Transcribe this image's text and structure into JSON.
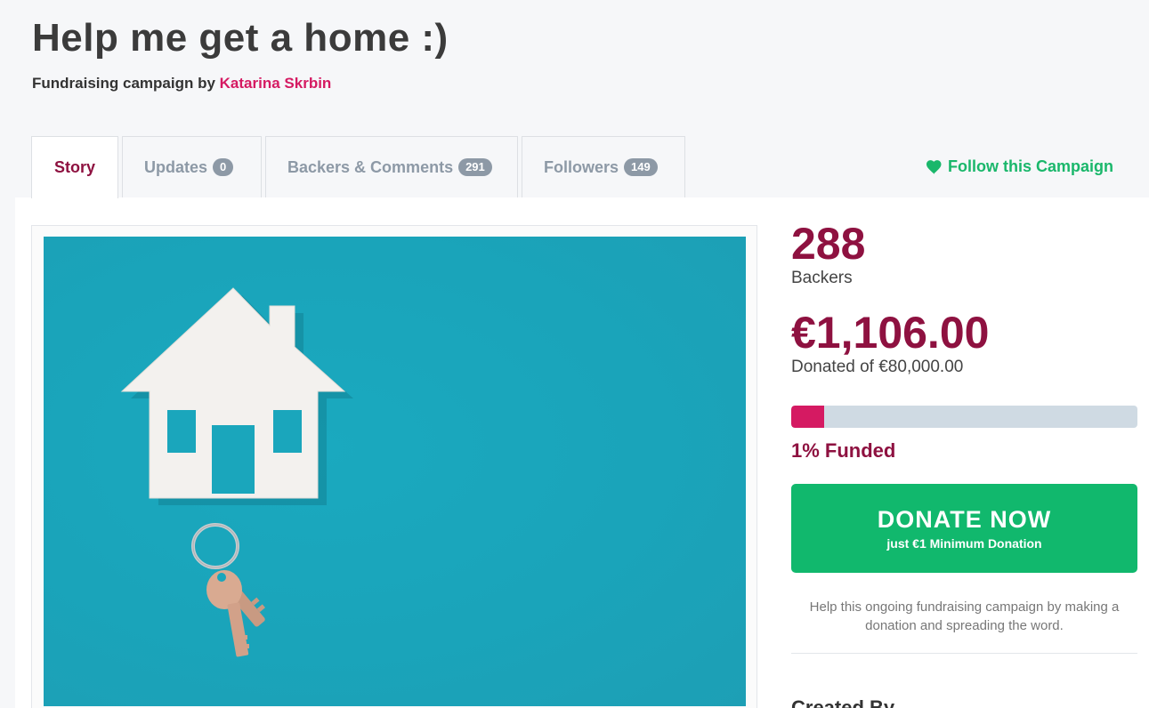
{
  "campaign": {
    "title": "Help me get a home :)",
    "subtitle_prefix": "Fundraising campaign by",
    "author": "Katarina Skrbin"
  },
  "tabs": [
    {
      "label": "Story",
      "count": null
    },
    {
      "label": "Updates",
      "count": "0"
    },
    {
      "label": "Backers & Comments",
      "count": "291"
    },
    {
      "label": "Followers",
      "count": "149"
    }
  ],
  "follow": {
    "label": "Follow this Campaign",
    "icon": "heart-icon"
  },
  "stats": {
    "backers_count": "288",
    "backers_label": "Backers",
    "raised": "€1,106.00",
    "raised_sub": "Donated of €80,000.00",
    "funded_percent": 1,
    "funded_label": "1% Funded"
  },
  "donate": {
    "label": "DONATE NOW",
    "sublabel": "just €1 Minimum Donation"
  },
  "help_text": "Help this ongoing fundraising campaign by making a donation and spreading the word.",
  "created_by_label": "Created By",
  "colors": {
    "brand": "#8e1140",
    "accent": "#d51a62",
    "success": "#11b86d",
    "image_bg": "#1aa4ba"
  }
}
